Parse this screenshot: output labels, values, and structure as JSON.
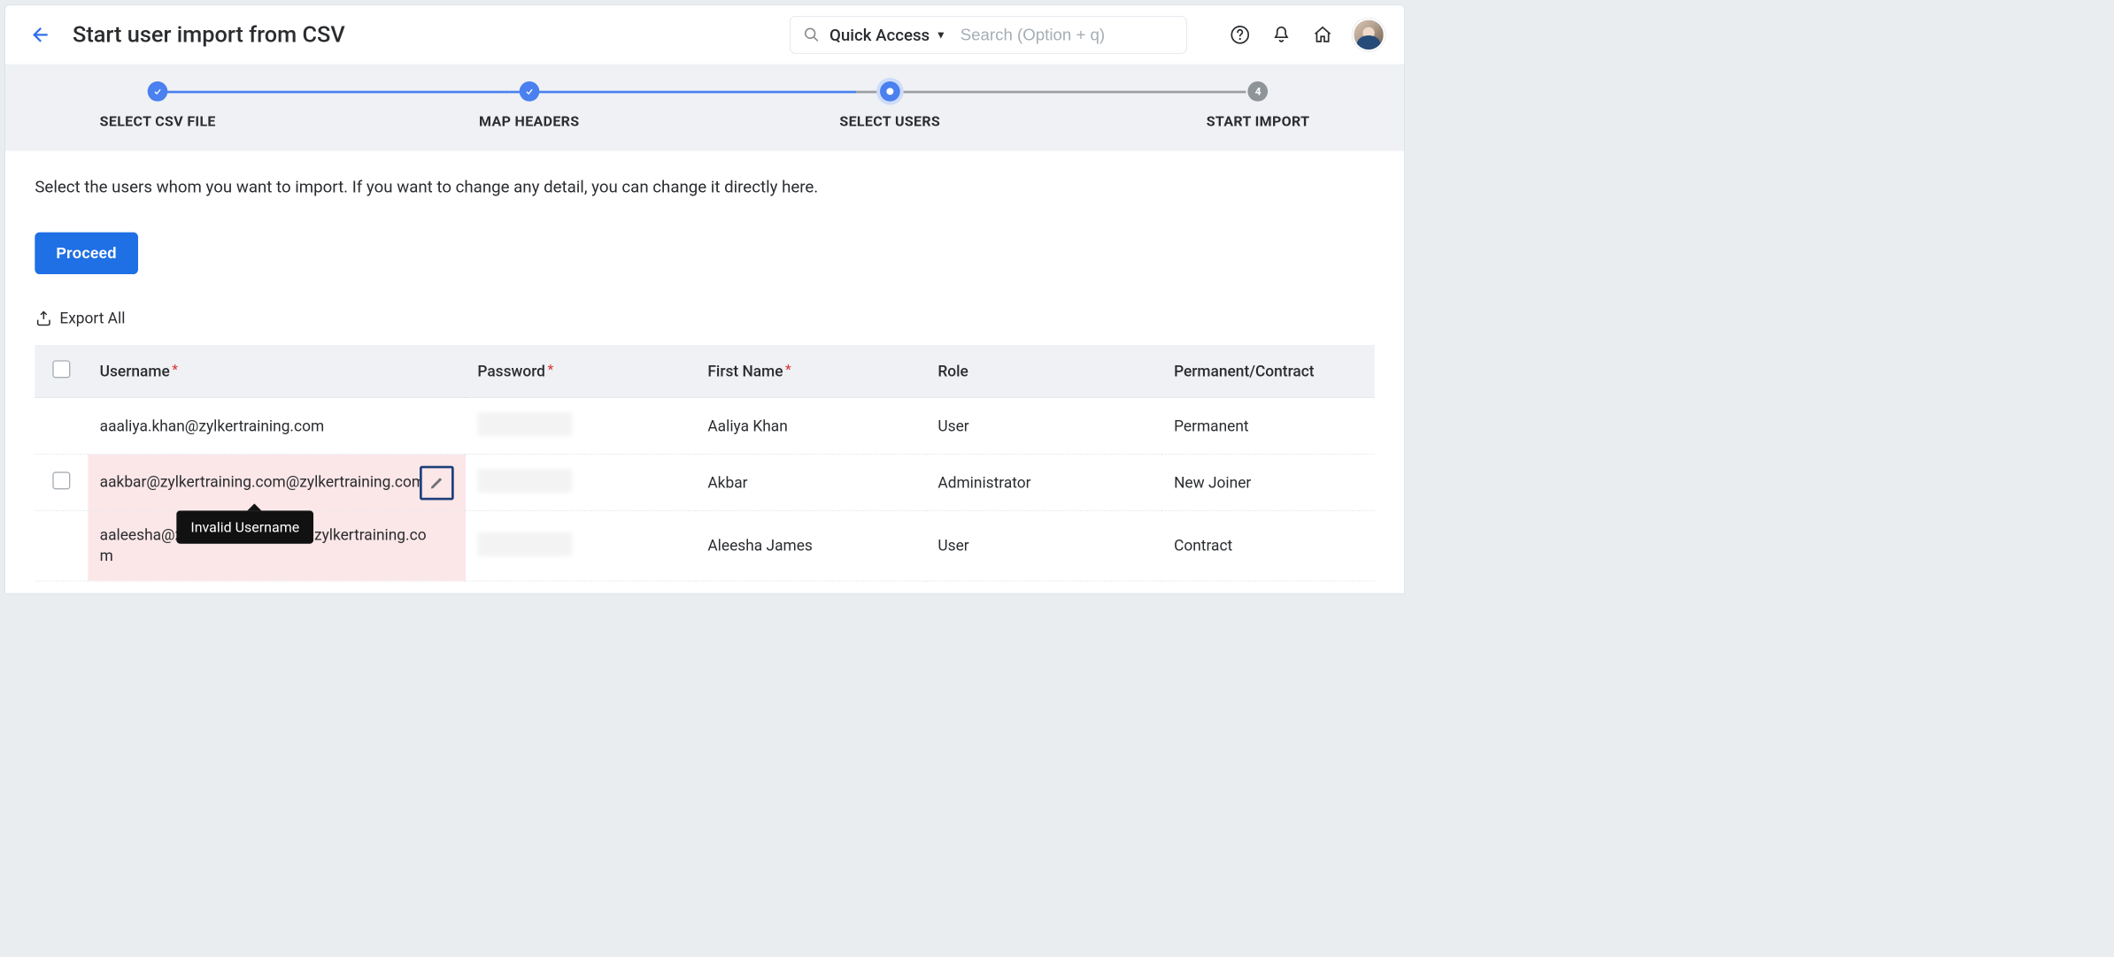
{
  "header": {
    "title": "Start user import from CSV",
    "quick_access_label": "Quick Access",
    "search_placeholder": "Search (Option + q)"
  },
  "stepper": {
    "steps": [
      {
        "label": "SELECT CSV FILE",
        "state": "done"
      },
      {
        "label": "MAP HEADERS",
        "state": "done"
      },
      {
        "label": "SELECT USERS",
        "state": "current"
      },
      {
        "label": "START IMPORT",
        "state": "pending",
        "num": "4"
      }
    ]
  },
  "body": {
    "instruction": "Select the users whom you want to import. If you want to change any detail, you can change it directly here.",
    "proceed_label": "Proceed",
    "export_label": "Export All"
  },
  "table": {
    "headers": {
      "username": "Username",
      "password": "Password",
      "first_name": "First Name",
      "role": "Role",
      "type": "Permanent/Contract"
    },
    "rows": [
      {
        "username": "aaaliya.khan@zylkertraining.com",
        "first_name": "Aaliya Khan",
        "role": "User",
        "type": "Permanent",
        "error": false
      },
      {
        "username": "aakbar@zylkertraining.com@zylkertraining.com",
        "first_name": "Akbar",
        "role": "Administrator",
        "type": "New Joiner",
        "error": true
      },
      {
        "username": "aaleesha@zylkertraining.com@zylkertraining.com",
        "first_name": "Aleesha James",
        "role": "User",
        "type": "Contract",
        "error": true
      }
    ]
  },
  "tooltip": {
    "text": "Invalid Username"
  }
}
